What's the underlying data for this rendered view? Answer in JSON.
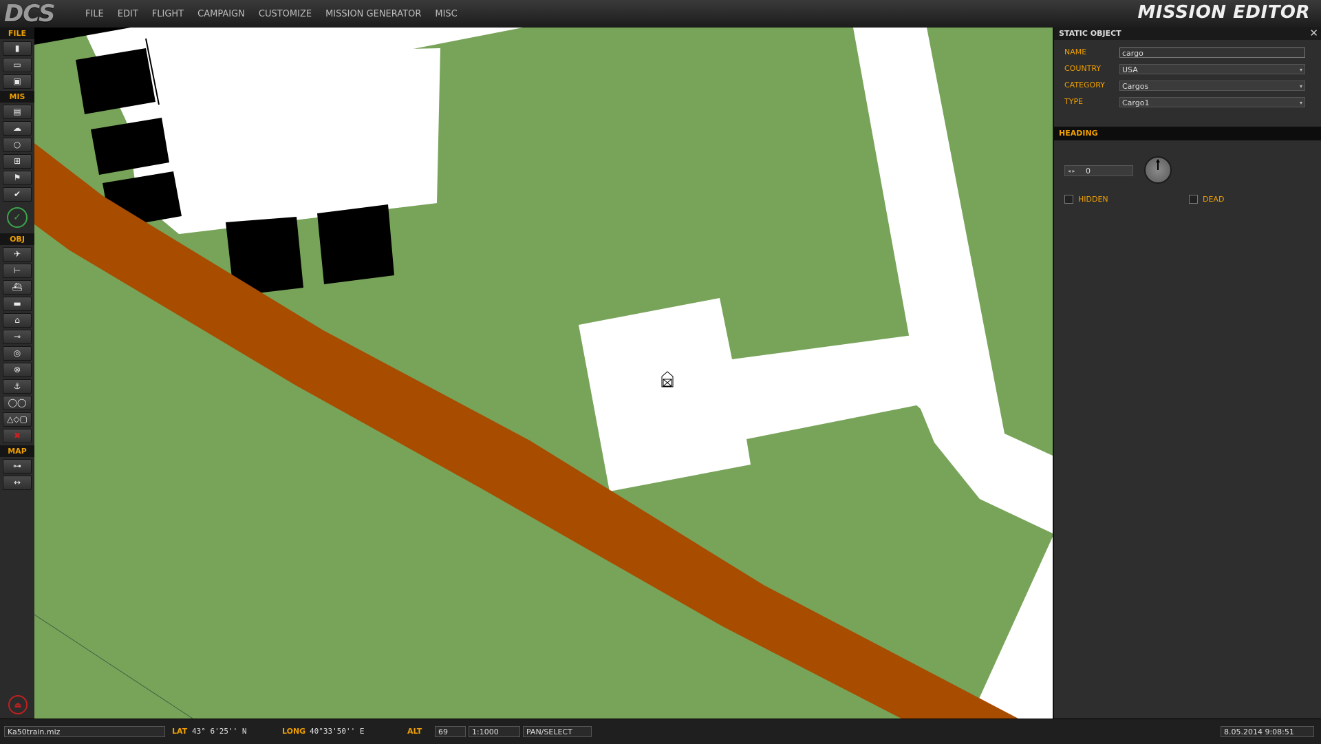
{
  "app": {
    "logo": "DCS",
    "title": "MISSION EDITOR"
  },
  "menu": [
    "FILE",
    "EDIT",
    "FLIGHT",
    "CAMPAIGN",
    "CUSTOMIZE",
    "MISSION GENERATOR",
    "MISC"
  ],
  "toolbar": {
    "file_label": "FILE",
    "mis_label": "MIS",
    "obj_label": "OBJ",
    "map_label": "MAP",
    "file_buttons": [
      "new-file-icon",
      "open-file-icon",
      "save-file-icon"
    ],
    "mis_buttons": [
      "briefing-icon",
      "weather-icon",
      "goals-icon",
      "triggers-icon",
      "failures-icon",
      "check-icon"
    ],
    "obj_buttons": [
      "plane-icon",
      "helicopter-icon",
      "ship-icon",
      "vehicle-icon",
      "static-icon",
      "airport-icon",
      "template-icon",
      "zone-icon",
      "nav-point-icon",
      "crew-icon",
      "shapes-icon",
      "delete-icon"
    ],
    "map_buttons": [
      "map-options-icon",
      "ruler-icon"
    ],
    "glyphs": {
      "file": [
        "▮",
        "▭",
        "▣"
      ],
      "mis": [
        "▤",
        "☁",
        "○",
        "⊞",
        "⚑",
        "✔"
      ],
      "obj": [
        "✈",
        "⊢",
        "⛴",
        "▬",
        "⌂",
        "⊸",
        "◎",
        "⊗",
        "⚓",
        "◯◯",
        "△◇▢",
        "✖"
      ],
      "map": [
        "⊶",
        "↔"
      ]
    },
    "clock_glyph": "✓",
    "exit_glyph": "⏏"
  },
  "panel": {
    "title": "STATIC OBJECT",
    "close": "✕",
    "fields": {
      "name": {
        "label": "NAME",
        "value": "cargo"
      },
      "country": {
        "label": "COUNTRY",
        "value": "USA"
      },
      "category": {
        "label": "CATEGORY",
        "value": "Cargos"
      },
      "type": {
        "label": "TYPE",
        "value": "Cargo1"
      }
    },
    "dropdown_arrow": "▾",
    "heading": {
      "label": "HEADING",
      "value": "0",
      "arrows": "◂ ▸"
    },
    "hidden_label": "HIDDEN",
    "dead_label": "DEAD"
  },
  "status": {
    "filename": "Ka50train.miz",
    "lat_label": "LAT",
    "lat_value": "43° 6'25'' N",
    "long_label": "LONG",
    "long_value": "40°33'50'' E",
    "alt_label": "ALT",
    "alt_value": "69",
    "scale": "1:1000",
    "mode": "PAN/SELECT",
    "datetime": "8.05.2014 9:08:51"
  },
  "colors": {
    "ground": "#78a45a",
    "road": "#a84c00",
    "building": "#000000",
    "area": "#ffffff",
    "accent": "#f0a000"
  }
}
